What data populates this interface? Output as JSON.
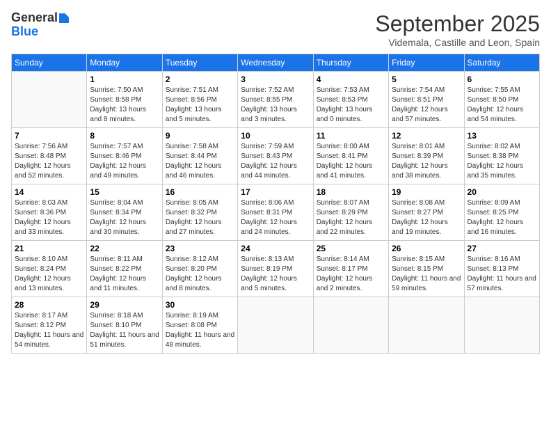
{
  "logo": {
    "general": "General",
    "blue": "Blue"
  },
  "header": {
    "month": "September 2025",
    "location": "Videmala, Castille and Leon, Spain"
  },
  "weekdays": [
    "Sunday",
    "Monday",
    "Tuesday",
    "Wednesday",
    "Thursday",
    "Friday",
    "Saturday"
  ],
  "weeks": [
    [
      {
        "day": null
      },
      {
        "day": 1,
        "sunrise": "Sunrise: 7:50 AM",
        "sunset": "Sunset: 8:58 PM",
        "daylight": "Daylight: 13 hours and 8 minutes."
      },
      {
        "day": 2,
        "sunrise": "Sunrise: 7:51 AM",
        "sunset": "Sunset: 8:56 PM",
        "daylight": "Daylight: 13 hours and 5 minutes."
      },
      {
        "day": 3,
        "sunrise": "Sunrise: 7:52 AM",
        "sunset": "Sunset: 8:55 PM",
        "daylight": "Daylight: 13 hours and 3 minutes."
      },
      {
        "day": 4,
        "sunrise": "Sunrise: 7:53 AM",
        "sunset": "Sunset: 8:53 PM",
        "daylight": "Daylight: 13 hours and 0 minutes."
      },
      {
        "day": 5,
        "sunrise": "Sunrise: 7:54 AM",
        "sunset": "Sunset: 8:51 PM",
        "daylight": "Daylight: 12 hours and 57 minutes."
      },
      {
        "day": 6,
        "sunrise": "Sunrise: 7:55 AM",
        "sunset": "Sunset: 8:50 PM",
        "daylight": "Daylight: 12 hours and 54 minutes."
      }
    ],
    [
      {
        "day": 7,
        "sunrise": "Sunrise: 7:56 AM",
        "sunset": "Sunset: 8:48 PM",
        "daylight": "Daylight: 12 hours and 52 minutes."
      },
      {
        "day": 8,
        "sunrise": "Sunrise: 7:57 AM",
        "sunset": "Sunset: 8:46 PM",
        "daylight": "Daylight: 12 hours and 49 minutes."
      },
      {
        "day": 9,
        "sunrise": "Sunrise: 7:58 AM",
        "sunset": "Sunset: 8:44 PM",
        "daylight": "Daylight: 12 hours and 46 minutes."
      },
      {
        "day": 10,
        "sunrise": "Sunrise: 7:59 AM",
        "sunset": "Sunset: 8:43 PM",
        "daylight": "Daylight: 12 hours and 44 minutes."
      },
      {
        "day": 11,
        "sunrise": "Sunrise: 8:00 AM",
        "sunset": "Sunset: 8:41 PM",
        "daylight": "Daylight: 12 hours and 41 minutes."
      },
      {
        "day": 12,
        "sunrise": "Sunrise: 8:01 AM",
        "sunset": "Sunset: 8:39 PM",
        "daylight": "Daylight: 12 hours and 38 minutes."
      },
      {
        "day": 13,
        "sunrise": "Sunrise: 8:02 AM",
        "sunset": "Sunset: 8:38 PM",
        "daylight": "Daylight: 12 hours and 35 minutes."
      }
    ],
    [
      {
        "day": 14,
        "sunrise": "Sunrise: 8:03 AM",
        "sunset": "Sunset: 8:36 PM",
        "daylight": "Daylight: 12 hours and 33 minutes."
      },
      {
        "day": 15,
        "sunrise": "Sunrise: 8:04 AM",
        "sunset": "Sunset: 8:34 PM",
        "daylight": "Daylight: 12 hours and 30 minutes."
      },
      {
        "day": 16,
        "sunrise": "Sunrise: 8:05 AM",
        "sunset": "Sunset: 8:32 PM",
        "daylight": "Daylight: 12 hours and 27 minutes."
      },
      {
        "day": 17,
        "sunrise": "Sunrise: 8:06 AM",
        "sunset": "Sunset: 8:31 PM",
        "daylight": "Daylight: 12 hours and 24 minutes."
      },
      {
        "day": 18,
        "sunrise": "Sunrise: 8:07 AM",
        "sunset": "Sunset: 8:29 PM",
        "daylight": "Daylight: 12 hours and 22 minutes."
      },
      {
        "day": 19,
        "sunrise": "Sunrise: 8:08 AM",
        "sunset": "Sunset: 8:27 PM",
        "daylight": "Daylight: 12 hours and 19 minutes."
      },
      {
        "day": 20,
        "sunrise": "Sunrise: 8:09 AM",
        "sunset": "Sunset: 8:25 PM",
        "daylight": "Daylight: 12 hours and 16 minutes."
      }
    ],
    [
      {
        "day": 21,
        "sunrise": "Sunrise: 8:10 AM",
        "sunset": "Sunset: 8:24 PM",
        "daylight": "Daylight: 12 hours and 13 minutes."
      },
      {
        "day": 22,
        "sunrise": "Sunrise: 8:11 AM",
        "sunset": "Sunset: 8:22 PM",
        "daylight": "Daylight: 12 hours and 11 minutes."
      },
      {
        "day": 23,
        "sunrise": "Sunrise: 8:12 AM",
        "sunset": "Sunset: 8:20 PM",
        "daylight": "Daylight: 12 hours and 8 minutes."
      },
      {
        "day": 24,
        "sunrise": "Sunrise: 8:13 AM",
        "sunset": "Sunset: 8:19 PM",
        "daylight": "Daylight: 12 hours and 5 minutes."
      },
      {
        "day": 25,
        "sunrise": "Sunrise: 8:14 AM",
        "sunset": "Sunset: 8:17 PM",
        "daylight": "Daylight: 12 hours and 2 minutes."
      },
      {
        "day": 26,
        "sunrise": "Sunrise: 8:15 AM",
        "sunset": "Sunset: 8:15 PM",
        "daylight": "Daylight: 11 hours and 59 minutes."
      },
      {
        "day": 27,
        "sunrise": "Sunrise: 8:16 AM",
        "sunset": "Sunset: 8:13 PM",
        "daylight": "Daylight: 11 hours and 57 minutes."
      }
    ],
    [
      {
        "day": 28,
        "sunrise": "Sunrise: 8:17 AM",
        "sunset": "Sunset: 8:12 PM",
        "daylight": "Daylight: 11 hours and 54 minutes."
      },
      {
        "day": 29,
        "sunrise": "Sunrise: 8:18 AM",
        "sunset": "Sunset: 8:10 PM",
        "daylight": "Daylight: 11 hours and 51 minutes."
      },
      {
        "day": 30,
        "sunrise": "Sunrise: 8:19 AM",
        "sunset": "Sunset: 8:08 PM",
        "daylight": "Daylight: 11 hours and 48 minutes."
      },
      {
        "day": null
      },
      {
        "day": null
      },
      {
        "day": null
      },
      {
        "day": null
      }
    ]
  ]
}
